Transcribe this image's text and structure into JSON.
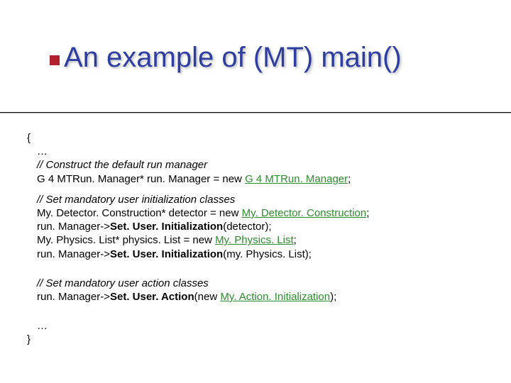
{
  "title": "An example of (MT) main()",
  "code": {
    "open_brace": "{",
    "ellipsis1": "…",
    "c1": "// Construct the default run manager",
    "l1a": "G 4 MTRun. Manager* run. Manager = new ",
    "l1b": "G 4 MTRun. Manager",
    "l1c": ";",
    "c2": "// Set mandatory user initialization classes",
    "l2a": "My. Detector. Construction* detector = new ",
    "l2b": "My. Detector. Construction",
    "l2c": ";",
    "l3a": "run. Manager->",
    "l3b": "Set. User. Initialization",
    "l3c": "(detector);",
    "l4a": "My. Physics. List* physics. List = new ",
    "l4b": "My. Physics. List",
    "l4c": ";",
    "l5a": "run. Manager->",
    "l5b": "Set. User. Initialization",
    "l5c": "(my. Physics. List);",
    "c3": "// Set mandatory user action classes",
    "l6a": "run. Manager->",
    "l6b": "Set. User. Action",
    "l6c": "(new ",
    "l6d": "My. Action. Initialization",
    "l6e": ");",
    "ellipsis2": "…",
    "close_brace": "}"
  }
}
